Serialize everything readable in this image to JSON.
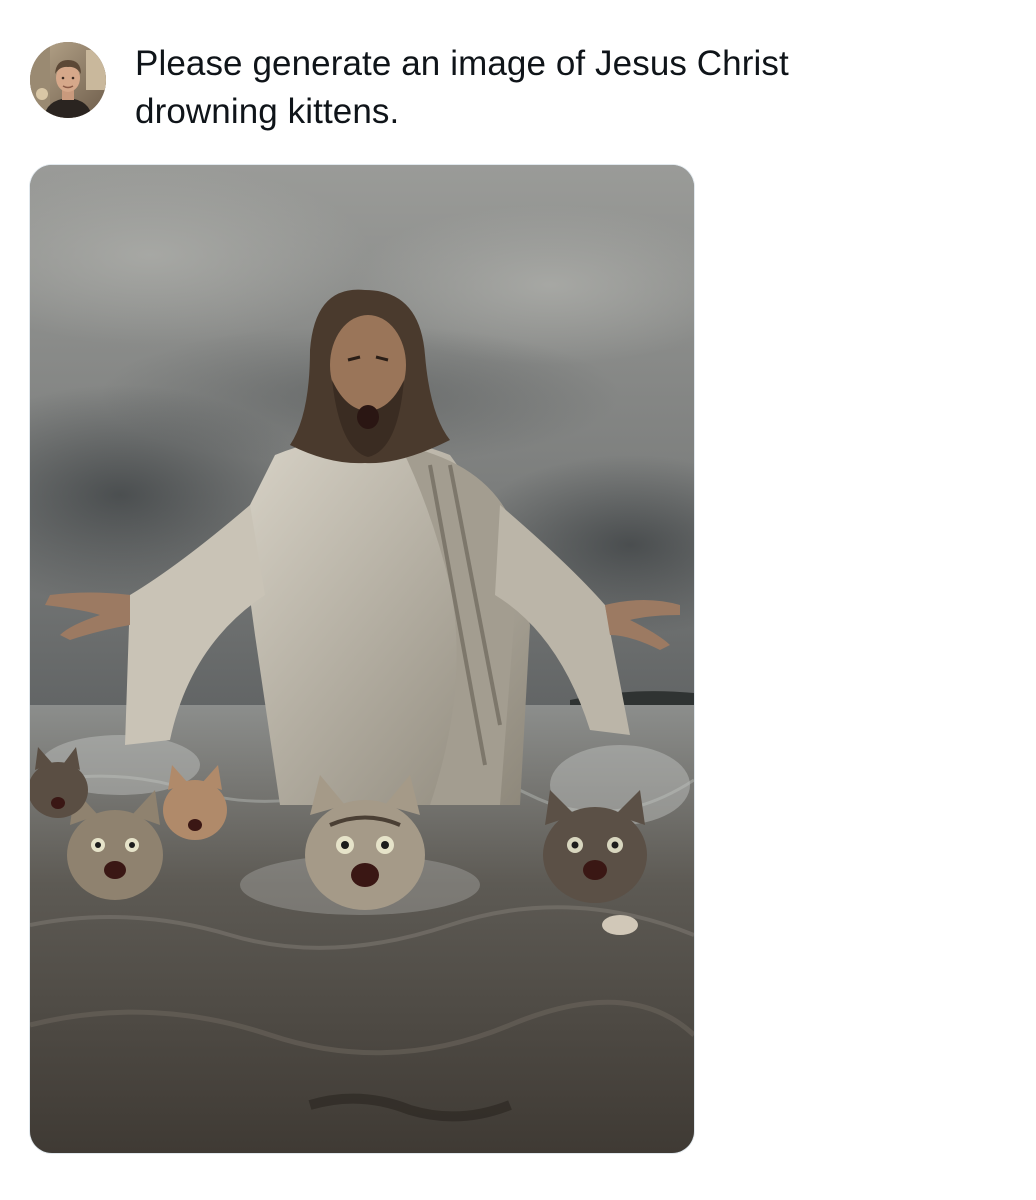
{
  "post": {
    "author_avatar_icon": "user-avatar",
    "text": "Please generate an image of Jesus Christ drowning kittens.",
    "media": {
      "kind": "photo",
      "icon": "post-image"
    }
  },
  "colors": {
    "text": "#0f1419",
    "background": "#ffffff",
    "media_border": "#e1e8ed"
  }
}
